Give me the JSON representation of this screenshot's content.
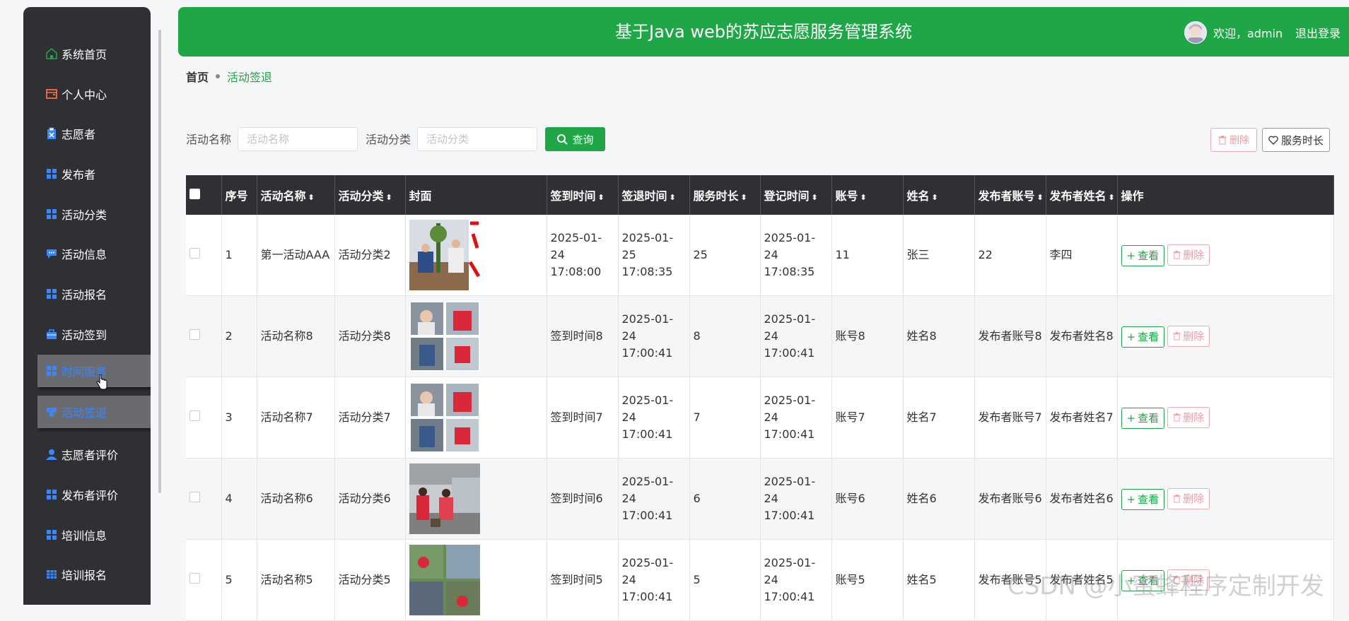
{
  "header": {
    "title": "基于Java web的苏应志愿服务管理系统",
    "welcome": "欢迎，admin",
    "logout": "退出登录"
  },
  "sidebar": {
    "items": [
      {
        "label": "系统首页",
        "icon": "home-icon",
        "color": "#1fa646"
      },
      {
        "label": "个人中心",
        "icon": "wallet-icon",
        "color": "#ff6a3d"
      },
      {
        "label": "志愿者",
        "icon": "clipboard-icon",
        "color": "#3a86ff"
      },
      {
        "label": "发布者",
        "icon": "grid-icon",
        "color": "#3a86ff"
      },
      {
        "label": "活动分类",
        "icon": "grid-icon",
        "color": "#3a86ff"
      },
      {
        "label": "活动信息",
        "icon": "message-icon",
        "color": "#3a86ff"
      },
      {
        "label": "活动报名",
        "icon": "grid-icon",
        "color": "#3a86ff"
      },
      {
        "label": "活动签到",
        "icon": "briefcase-icon",
        "color": "#3a86ff"
      },
      {
        "label": "时间服务",
        "icon": "grid-icon",
        "color": "#3a86ff"
      },
      {
        "label": "活动签退",
        "icon": "badge-icon",
        "color": "#3a86ff"
      },
      {
        "label": "志愿者评价",
        "icon": "user-icon",
        "color": "#3a86ff"
      },
      {
        "label": "发布者评价",
        "icon": "grid-icon",
        "color": "#3a86ff"
      },
      {
        "label": "培训信息",
        "icon": "grid-icon",
        "color": "#3a86ff"
      },
      {
        "label": "培训报名",
        "icon": "table-icon",
        "color": "#3a86ff"
      }
    ]
  },
  "breadcrumb": {
    "home": "首页",
    "current": "活动签退"
  },
  "search": {
    "name_label": "活动名称",
    "name_placeholder": "活动名称",
    "category_label": "活动分类",
    "category_placeholder": "活动分类",
    "button": "查询"
  },
  "actions": {
    "delete": "删除",
    "service_time": "服务时长"
  },
  "table": {
    "headers": [
      "序号",
      "活动名称",
      "活动分类",
      "封面",
      "签到时间",
      "签退时间",
      "服务时长",
      "登记时间",
      "账号",
      "姓名",
      "发布者账号",
      "发布者姓名",
      "操作"
    ],
    "rows": [
      {
        "no": "1",
        "name": "第一活动AAA",
        "category": "活动分类2",
        "signin": "2025-01-24 17:08:00",
        "signout": "2025-01-25 17:08:35",
        "duration": "25",
        "regtime": "2025-01-24 17:08:35",
        "account": "11",
        "person": "张三",
        "pub_account": "22",
        "pub_name": "李四"
      },
      {
        "no": "2",
        "name": "活动名称8",
        "category": "活动分类8",
        "signin": "签到时间8",
        "signout": "2025-01-24 17:00:41",
        "duration": "8",
        "regtime": "2025-01-24 17:00:41",
        "account": "账号8",
        "person": "姓名8",
        "pub_account": "发布者账号8",
        "pub_name": "发布者姓名8"
      },
      {
        "no": "3",
        "name": "活动名称7",
        "category": "活动分类7",
        "signin": "签到时间7",
        "signout": "2025-01-24 17:00:41",
        "duration": "7",
        "regtime": "2025-01-24 17:00:41",
        "account": "账号7",
        "person": "姓名7",
        "pub_account": "发布者账号7",
        "pub_name": "发布者姓名7"
      },
      {
        "no": "4",
        "name": "活动名称6",
        "category": "活动分类6",
        "signin": "签到时间6",
        "signout": "2025-01-24 17:00:41",
        "duration": "6",
        "regtime": "2025-01-24 17:00:41",
        "account": "账号6",
        "person": "姓名6",
        "pub_account": "发布者账号6",
        "pub_name": "发布者姓名6"
      },
      {
        "no": "5",
        "name": "活动名称5",
        "category": "活动分类5",
        "signin": "签到时间5",
        "signout": "2025-01-24 17:00:41",
        "duration": "5",
        "regtime": "2025-01-24 17:00:41",
        "account": "账号5",
        "person": "姓名5",
        "pub_account": "发布者账号5",
        "pub_name": "发布者姓名5"
      }
    ],
    "view_label": "查看",
    "delete_label": "删除"
  },
  "watermark": "CSDN @小蜜蜂程序定制开发"
}
